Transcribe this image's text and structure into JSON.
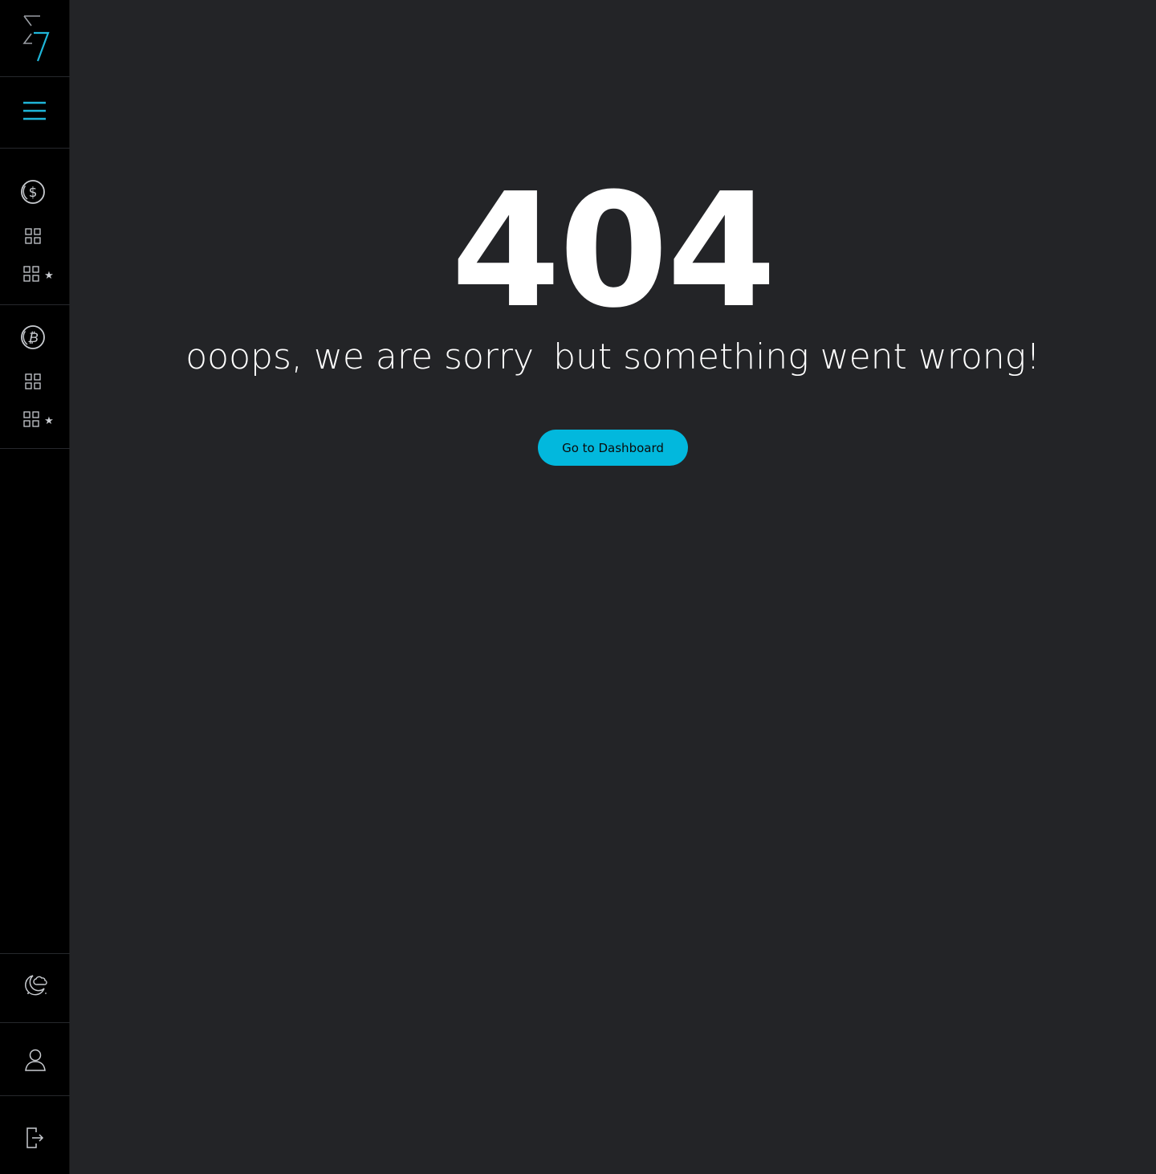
{
  "error": {
    "code": "404",
    "message_part1": "ooops, we are sorry",
    "message_part2": "but something went wrong!",
    "button_label": "Go to Dashboard"
  },
  "sidebar": {
    "logo": "logo-icon",
    "menu": "hamburger-menu-icon",
    "fiat_group": {
      "icon": "dollar-coin-icon",
      "items": [
        "grid-icon",
        "grid-favorites-icon"
      ]
    },
    "crypto_group": {
      "icon": "bitcoin-icon",
      "items": [
        "grid-icon",
        "grid-favorites-icon"
      ]
    },
    "bottom": [
      "theme-toggle-icon",
      "user-icon",
      "logout-icon"
    ]
  },
  "colors": {
    "accent": "#02b8dd",
    "background": "#232427",
    "sidebar": "#000000",
    "text": "#ffffff"
  }
}
